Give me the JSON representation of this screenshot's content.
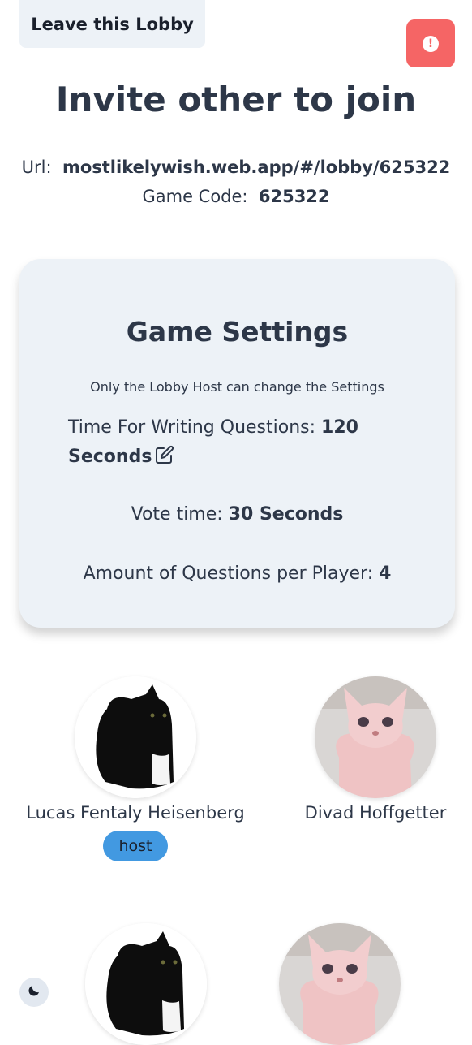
{
  "header": {
    "leave_label": "Leave this Lobby",
    "alert_icon": "exclamation-icon",
    "alert_color": "#f56565"
  },
  "invite": {
    "title": "Invite other to join",
    "url_label": "Url:",
    "url_value": "mostlikelywish.web.app/#/lobby/625322",
    "code_label": "Game Code:",
    "code_value": "625322"
  },
  "settings": {
    "title": "Game Settings",
    "note": "Only the Lobby Host can change the Settings",
    "writing_label": "Time For Writing Questions:",
    "writing_value": "120 Seconds",
    "edit_icon": "edit-icon",
    "vote_label": "Vote time:",
    "vote_value": "30 Seconds",
    "amount_label": "Amount of Questions per Player:",
    "amount_value": "4"
  },
  "players": [
    {
      "name": "Lucas Fentaly Heisenberg",
      "badge": "host",
      "avatar": "black-cat-avatar"
    },
    {
      "name": "Divad Hoffgetter",
      "avatar": "sphynx-cat-avatar"
    },
    {
      "name": "",
      "avatar": "black-cat-avatar"
    },
    {
      "name": "",
      "avatar": "sphynx-cat-avatar"
    }
  ],
  "theme_toggle": {
    "icon": "moon-icon"
  },
  "colors": {
    "accent": "#4299e1",
    "card_bg": "#edf2f7",
    "text": "#2d3748"
  }
}
